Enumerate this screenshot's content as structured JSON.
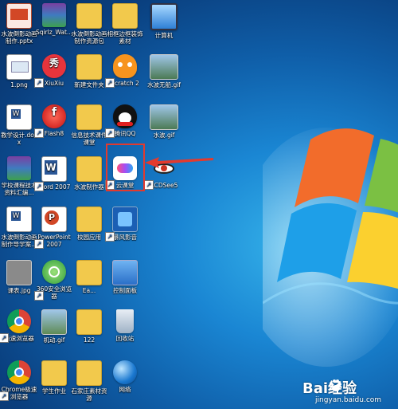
{
  "desktop": {
    "icons": [
      {
        "label": "水波倒影动画制作.pptx",
        "icon": "pptx-file-icon"
      },
      {
        "label": "Sqirlz_Wat...",
        "icon": "winrar-archive-icon"
      },
      {
        "label": "水波倒影动画制作资源包",
        "icon": "folder-icon"
      },
      {
        "label": "相框边框装饰素材",
        "icon": "folder-icon"
      },
      {
        "label": "计算机",
        "icon": "computer-icon"
      },
      {
        "label": "1.png",
        "icon": "png-file-icon"
      },
      {
        "label": "XiuXiu",
        "icon": "xiuxiu-app-icon"
      },
      {
        "label": "新建文件夹",
        "icon": "folder-icon"
      },
      {
        "label": "Scratch 2",
        "icon": "scratch-cat-icon"
      },
      {
        "label": "水波无船.gif",
        "icon": "gif-image-icon"
      },
      {
        "label": "教学设计.docx",
        "icon": "docx-file-icon"
      },
      {
        "label": "Flash8",
        "icon": "flash-app-icon"
      },
      {
        "label": "信息技术课件课堂",
        "icon": "folder-icon"
      },
      {
        "label": "腾讯QQ",
        "icon": "qq-penguin-icon"
      },
      {
        "label": "水波.gif",
        "icon": "gif-image-icon"
      },
      {
        "label": "学校课程技术资料汇编...",
        "icon": "winrar-archive-icon"
      },
      {
        "label": "Word 2007",
        "icon": "word-app-icon"
      },
      {
        "label": "水波制作器",
        "icon": "folder-icon"
      },
      {
        "label": "云课堂",
        "icon": "cloud-classroom-icon"
      },
      {
        "label": "ACDSee5",
        "icon": "acdsee-eye-icon"
      },
      {
        "label": "水波倒影动画制作导学案...",
        "icon": "doc-file-icon"
      },
      {
        "label": "PowerPoint 2007",
        "icon": "powerpoint-app-icon"
      },
      {
        "label": "校园应用",
        "icon": "folder-icon"
      },
      {
        "label": "暴风影音",
        "icon": "storm-player-icon"
      },
      {
        "label": "课表.jpg",
        "icon": "jpg-image-icon"
      },
      {
        "label": "360安全浏览器",
        "icon": "360-browser-icon"
      },
      {
        "label": "Ea...",
        "icon": "folder-icon"
      },
      {
        "label": "控制面板",
        "icon": "control-panel-icon"
      },
      {
        "label": "极速浏览器",
        "icon": "chrome-icon"
      },
      {
        "label": "机动.gif",
        "icon": "gif-image-icon"
      },
      {
        "label": "122",
        "icon": "folder-icon"
      },
      {
        "label": "回收站",
        "icon": "recycle-bin-icon"
      },
      {
        "label": "Chrome极速浏览器",
        "icon": "chrome-icon"
      },
      {
        "label": "学生作业",
        "icon": "folder-icon"
      },
      {
        "label": "石家庄素材资源",
        "icon": "folder-icon"
      },
      {
        "label": "网络",
        "icon": "network-globe-icon"
      }
    ]
  },
  "watermark": {
    "main": "Bai经验",
    "sub": "jingyan.baidu.com"
  },
  "colors": {
    "highlight": "#e23a2e",
    "folder": "#f2c94c",
    "desktop_center": "#35b2ea",
    "desktop_edge": "#082f62"
  }
}
